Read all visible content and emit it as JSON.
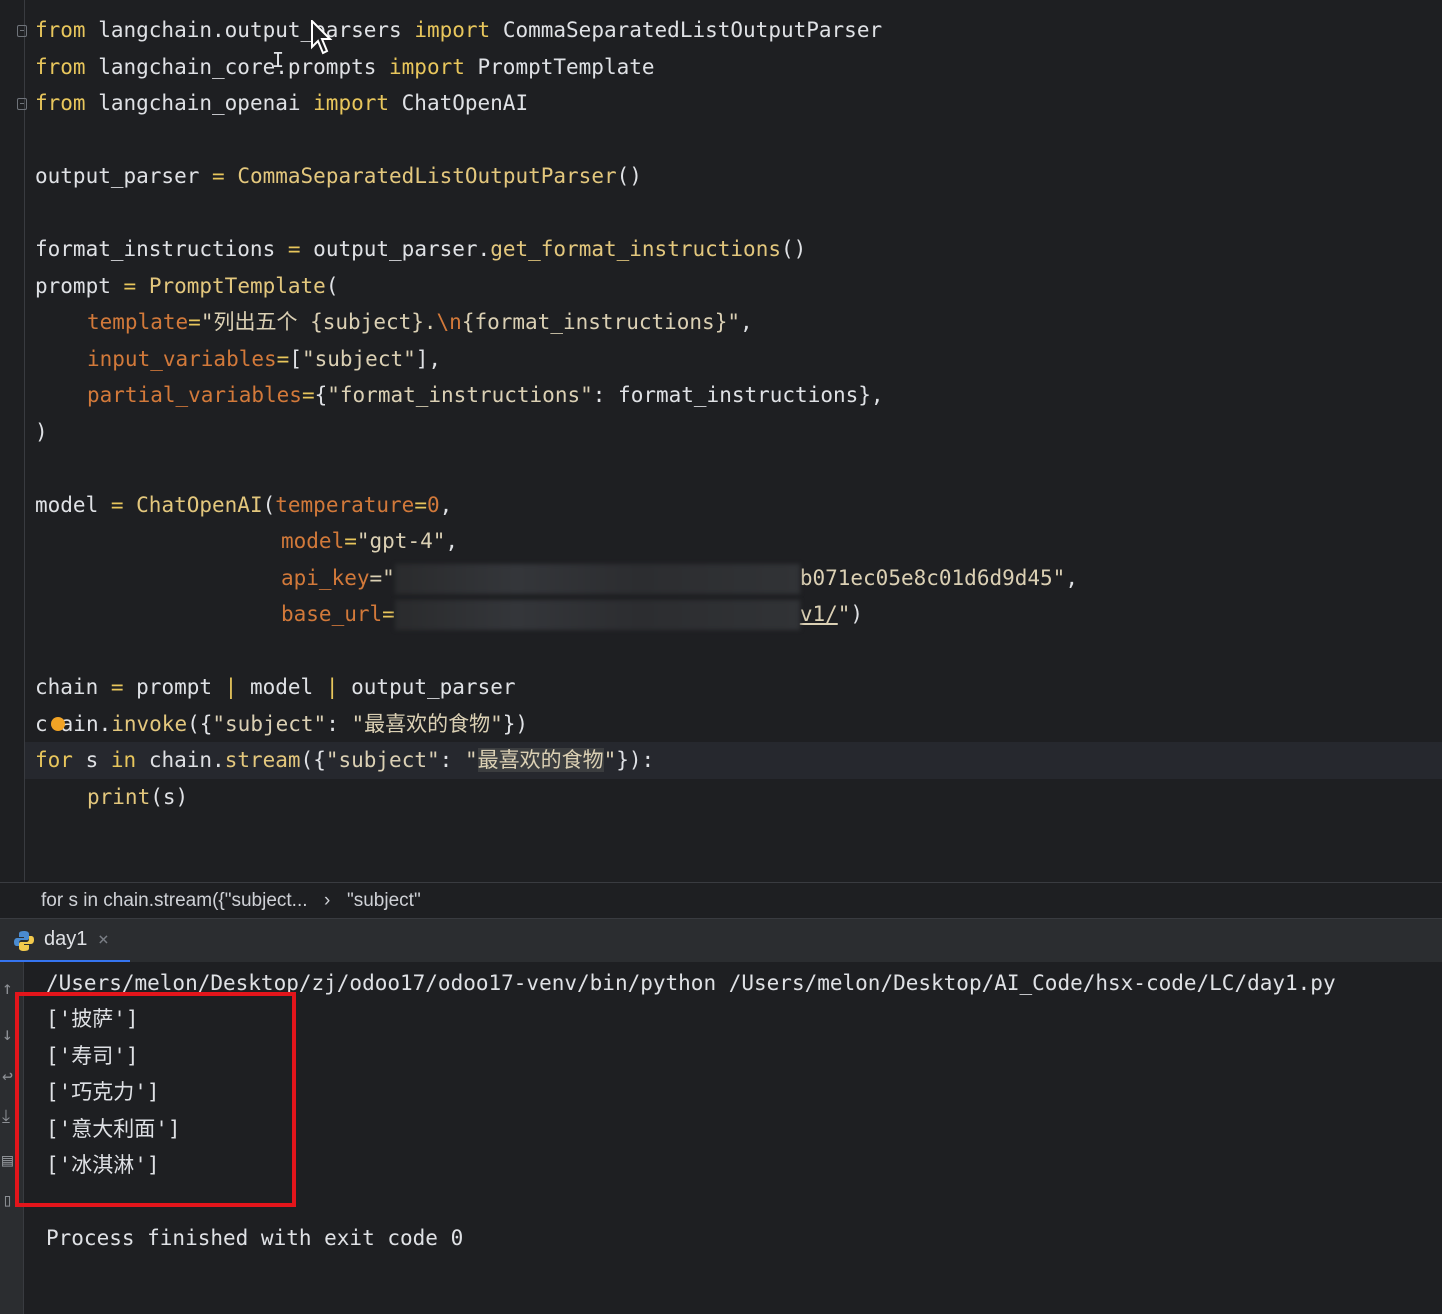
{
  "editor": {
    "lines": {
      "l1": {
        "a": "from",
        "b": " langchain.output_parsers ",
        "c": "import",
        "d": " CommaSeparatedListOutputParser"
      },
      "l2": {
        "a": "from",
        "b": " langchain_core.prompts ",
        "c": "import",
        "d": " PromptTemplate"
      },
      "l3": {
        "a": "from",
        "b": " langchain_openai ",
        "c": "import",
        "d": " ChatOpenAI"
      },
      "l5": {
        "a": "output_parser ",
        "b": "=",
        "c": " CommaSeparatedListOutputParser",
        "d": "()"
      },
      "l7": {
        "a": "format_instructions ",
        "b": "=",
        "c": " output_parser.",
        "d": "get_format_instructions",
        "e": "()"
      },
      "l8": {
        "a": "prompt ",
        "b": "=",
        "c": " PromptTemplate",
        "d": "("
      },
      "l9": {
        "a": "template",
        "b": "=",
        "c": "\"列出五个 {subject}.",
        "d": "\\n",
        "e": "{format_instructions}\"",
        "f": ","
      },
      "l10": {
        "a": "input_variables",
        "b": "=",
        "c": "[",
        "d": "\"subject\"",
        "e": "],"
      },
      "l11": {
        "a": "partial_variables",
        "b": "=",
        "c": "{",
        "d": "\"format_instructions\"",
        "e": ": format_instructions},"
      },
      "l12": {
        "a": ")"
      },
      "l14": {
        "a": "model ",
        "b": "=",
        "c": " ChatOpenAI",
        "d": "(",
        "e": "temperature",
        "f": "=",
        "g": "0",
        ",": ","
      },
      "l15": {
        "a": "model",
        "b": "=",
        "c": "\"gpt-4\"",
        "d": ","
      },
      "l16": {
        "a": "api_key",
        "b": "=\"",
        "c": "b071ec05e8c01d6d9d45\"",
        "d": ","
      },
      "l17": {
        "a": "base_url",
        "b": "=",
        "c": "v1/",
        "d": "\"",
        ")": ")"
      },
      "l19": {
        "a": "chain ",
        "b": "=",
        "c": " prompt ",
        "d": "|",
        "e": " model ",
        "f": "|",
        "g": " output_parser"
      },
      "l20": {
        "a": "c",
        "b": "ain.",
        "c": "invoke",
        "d": "({",
        "e": "\"subject\"",
        "f": ": ",
        "g": "\"最喜欢的食物\"",
        "h": "})"
      },
      "l21": {
        "a": "for",
        "b": " s ",
        "c": "in",
        "d": " chain.",
        "e": "stream",
        "f": "({",
        "g": "\"subject\"",
        "h": ": ",
        "i": "\"",
        "j": "最喜欢的食物",
        "k": "\"",
        "l": "}):"
      },
      "l22": {
        "a": "print",
        "b": "(s)"
      }
    }
  },
  "breadcrumb": {
    "item1": "for s in chain.stream({\"subject...",
    "separator": "›",
    "item2": "\"subject\""
  },
  "run": {
    "tab_label": "day1",
    "tab_close": "×",
    "command": "/Users/melon/Desktop/zj/odoo17/odoo17-venv/bin/python /Users/melon/Desktop/AI_Code/hsx-code/LC/day1.py",
    "output": [
      "['披萨']",
      "['寿司']",
      "['巧克力']",
      "['意大利面']",
      "['冰淇淋']"
    ],
    "exit_message": "Process finished with exit code 0"
  },
  "colors": {
    "background": "#1e1f22",
    "keyword": "#e8c65c",
    "string": "#dbd0b4",
    "parameter": "#d2793a",
    "highlight_box": "#e3151b",
    "tab_underline": "#3574f0"
  }
}
